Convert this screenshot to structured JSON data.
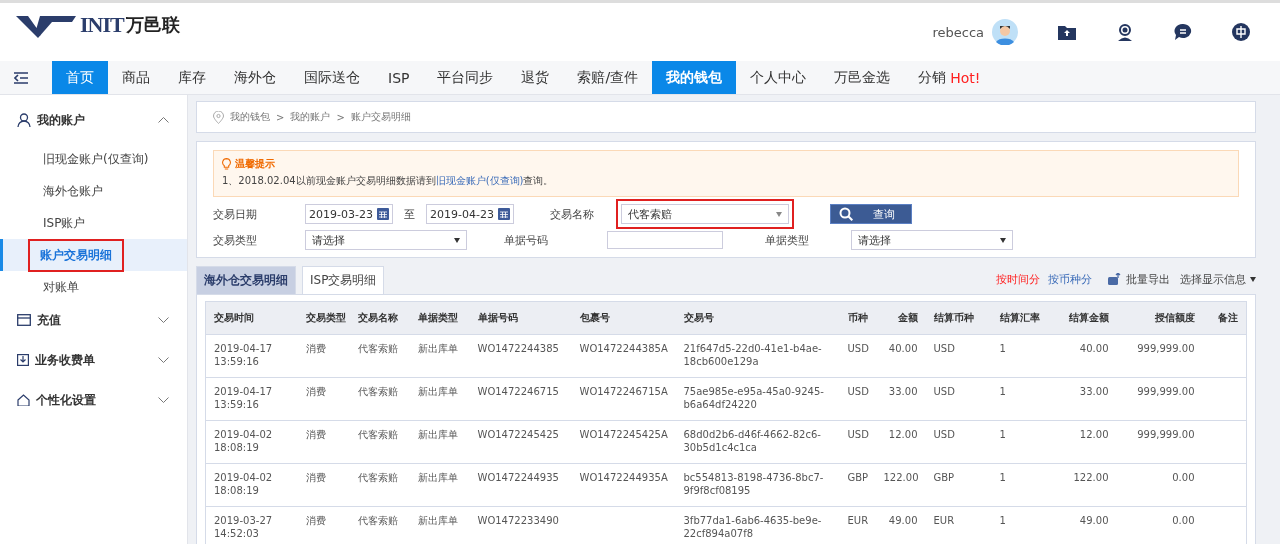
{
  "header": {
    "logo_text": "INIT",
    "logo_name": "万邑联",
    "user": "rebecca"
  },
  "nav": [
    {
      "label": "首页",
      "selected": true
    },
    {
      "label": "商品",
      "selected": false
    },
    {
      "label": "库存",
      "selected": false
    },
    {
      "label": "海外仓",
      "selected": false
    },
    {
      "label": "国际送仓",
      "selected": false
    },
    {
      "label": "ISP",
      "selected": false
    },
    {
      "label": "平台同步",
      "selected": false
    },
    {
      "label": "退货",
      "selected": false
    },
    {
      "label": "索赔/查件",
      "selected": false
    },
    {
      "label": "我的钱包",
      "selected": true
    },
    {
      "label": "个人中心",
      "selected": false
    },
    {
      "label": "万邑金选",
      "selected": false
    },
    {
      "label": "分销",
      "badge": "Hot!",
      "selected": false
    }
  ],
  "sidebar": [
    {
      "label": "我的账户",
      "expanded": true,
      "items": [
        {
          "label": "旧现金账户(仅查询)",
          "selected": false,
          "annotated": false
        },
        {
          "label": "海外仓账户",
          "selected": false,
          "annotated": false
        },
        {
          "label": "ISP账户",
          "selected": false,
          "annotated": false
        },
        {
          "label": "账户交易明细",
          "selected": true,
          "annotated": true
        },
        {
          "label": "对账单",
          "selected": false,
          "annotated": false
        }
      ]
    },
    {
      "label": "充值",
      "expanded": false
    },
    {
      "label": "业务收费单",
      "expanded": false
    },
    {
      "label": "个性化设置",
      "expanded": false
    }
  ],
  "breadcrumb": [
    {
      "label": "我的钱包"
    },
    {
      "separator": ">",
      "label": "我的账户"
    },
    {
      "separator": ">",
      "label": "账户交易明细"
    }
  ],
  "notice": {
    "title": "温馨提示",
    "text_before": "1、2018.02.04以前现金账户交易明细数据请到",
    "link": "旧现金账户(仅查询)",
    "text_after": "查询。"
  },
  "filters": {
    "date_label": "交易日期",
    "date_from": "2019-03-23",
    "date_sep": "至",
    "date_to": "2019-04-23",
    "name_label": "交易名称",
    "name_value": "代客索赔",
    "name_annotated": true,
    "search_button": "查询",
    "type_label": "交易类型",
    "type_placeholder": "请选择",
    "docno_label": "单据号码",
    "doctype_label": "单据类型",
    "doctype_placeholder": "请选择"
  },
  "tabs": [
    {
      "label": "海外仓交易明细",
      "selected": true
    },
    {
      "label": "ISP交易明细",
      "selected": false
    }
  ],
  "toolbar": {
    "groupings": [
      {
        "label": "按时间分",
        "selected": true
      },
      {
        "label": "按币种分",
        "selected": false
      }
    ],
    "export": "批量导出",
    "columns_menu": "选择显示信息"
  },
  "table": {
    "columns": [
      {
        "label": "交易时间",
        "kind": "text"
      },
      {
        "label": "交易类型",
        "kind": "text"
      },
      {
        "label": "交易名称",
        "kind": "text"
      },
      {
        "label": "单据类型",
        "kind": "text"
      },
      {
        "label": "单据号码",
        "kind": "text"
      },
      {
        "label": "包裹号",
        "kind": "text"
      },
      {
        "label": "交易号",
        "kind": "text"
      },
      {
        "label": "币种",
        "kind": "text"
      },
      {
        "label": "金额",
        "kind": "number"
      },
      {
        "label": "结算币种",
        "kind": "text"
      },
      {
        "label": "结算汇率",
        "kind": "text"
      },
      {
        "label": "结算金额",
        "kind": "number"
      },
      {
        "label": "授信额度",
        "kind": "number"
      },
      {
        "label": "备注",
        "kind": "number"
      }
    ],
    "rows": [
      [
        "2019-04-17 13:59:16",
        "消费",
        "代客索赔",
        "新出库单",
        "WO1472244385",
        "WO1472244385A",
        "21f647d5-22d0-41e1-b4ae-18cb600e129a",
        "USD",
        "40.00",
        "USD",
        "1",
        "40.00",
        "999,999.00",
        ""
      ],
      [
        "2019-04-17 13:59:16",
        "消费",
        "代客索赔",
        "新出库单",
        "WO1472246715",
        "WO1472246715A",
        "75ae985e-e95a-45a0-9245-b6a64df24220",
        "USD",
        "33.00",
        "USD",
        "1",
        "33.00",
        "999,999.00",
        ""
      ],
      [
        "2019-04-02 18:08:19",
        "消费",
        "代客索赔",
        "新出库单",
        "WO1472245425",
        "WO1472245425A",
        "68d0d2b6-d46f-4662-82c6-30b5d1c4c1ca",
        "USD",
        "12.00",
        "USD",
        "1",
        "12.00",
        "999,999.00",
        ""
      ],
      [
        "2019-04-02 18:08:19",
        "消费",
        "代客索赔",
        "新出库单",
        "WO1472244935",
        "WO1472244935A",
        "bc554813-8198-4736-8bc7-9f9f8cf08195",
        "GBP",
        "122.00",
        "GBP",
        "1",
        "122.00",
        "0.00",
        ""
      ],
      [
        "2019-03-27 14:52:03",
        "消费",
        "代客索赔",
        "新出库单",
        "WO1472233490",
        "",
        "3fb77da1-6ab6-4635-be9e-22cf894a07f8",
        "EUR",
        "49.00",
        "EUR",
        "1",
        "49.00",
        "0.00",
        ""
      ]
    ]
  }
}
